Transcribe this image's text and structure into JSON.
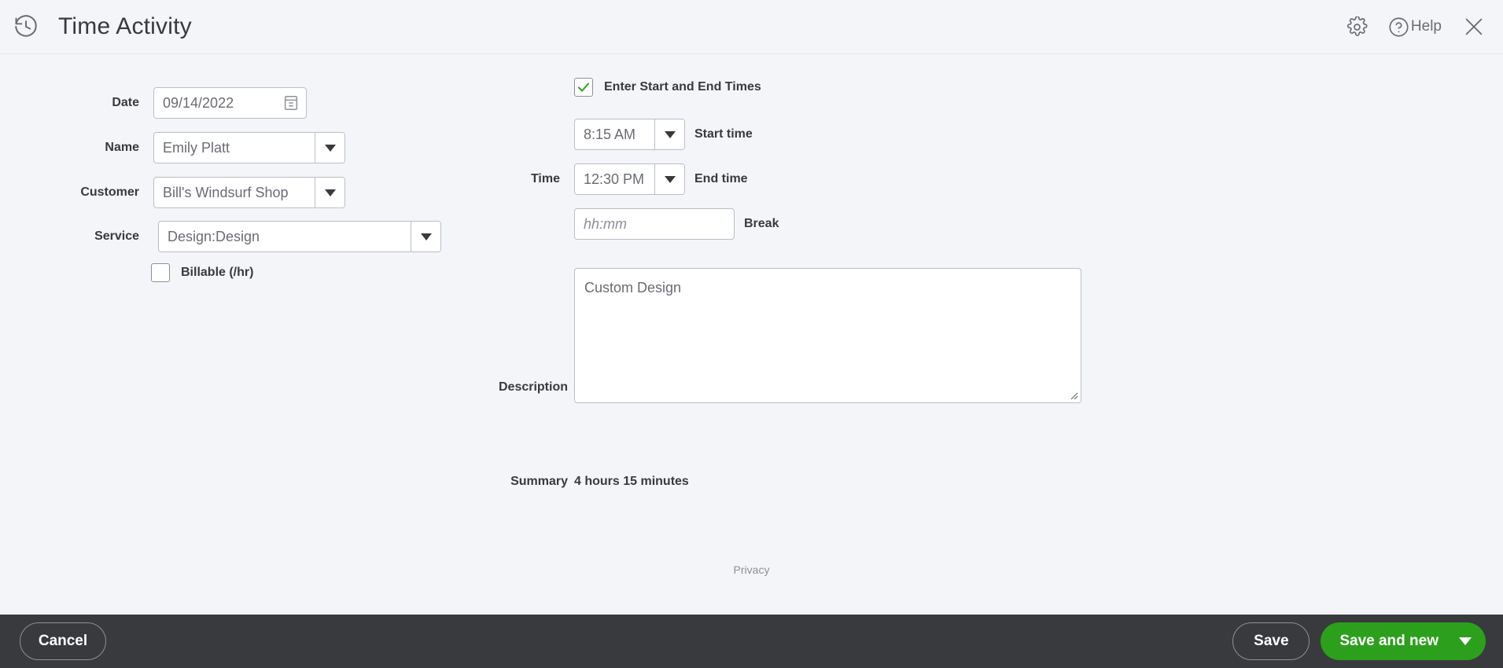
{
  "header": {
    "title": "Time Activity",
    "history_icon": "history-clock-icon",
    "gear_icon": "gear-icon",
    "help_icon": "help-circle-icon",
    "help_label": "Help",
    "close_icon": "close-icon"
  },
  "form": {
    "date": {
      "label": "Date",
      "value": "09/14/2022",
      "icon": "calendar-picker-icon"
    },
    "name": {
      "label": "Name",
      "value": "Emily Platt"
    },
    "customer": {
      "label": "Customer",
      "value": "Bill's Windsurf Shop"
    },
    "service": {
      "label": "Service",
      "value": "Design:Design"
    },
    "billable": {
      "label": "Billable (/hr)",
      "checked": false
    },
    "enter_times": {
      "label": "Enter Start and End Times",
      "checked": true
    },
    "time_label": "Time",
    "start_time": {
      "label": "Start time",
      "value": "8:15 AM"
    },
    "end_time": {
      "label": "End time",
      "value": "12:30 PM"
    },
    "break": {
      "label": "Break",
      "value": "",
      "placeholder": "hh:mm"
    },
    "description": {
      "label": "Description",
      "value": "Custom Design"
    },
    "summary": {
      "label": "Summary",
      "value": "4 hours 15 minutes"
    },
    "privacy_link": "Privacy"
  },
  "footer": {
    "cancel_label": "Cancel",
    "save_label": "Save",
    "save_and_new_label": "Save and new"
  },
  "colors": {
    "brand_green": "#2ca01c",
    "footer_dark": "#393a3d",
    "page_background": "#f4f5f8",
    "field_border": "#b9bec7"
  }
}
